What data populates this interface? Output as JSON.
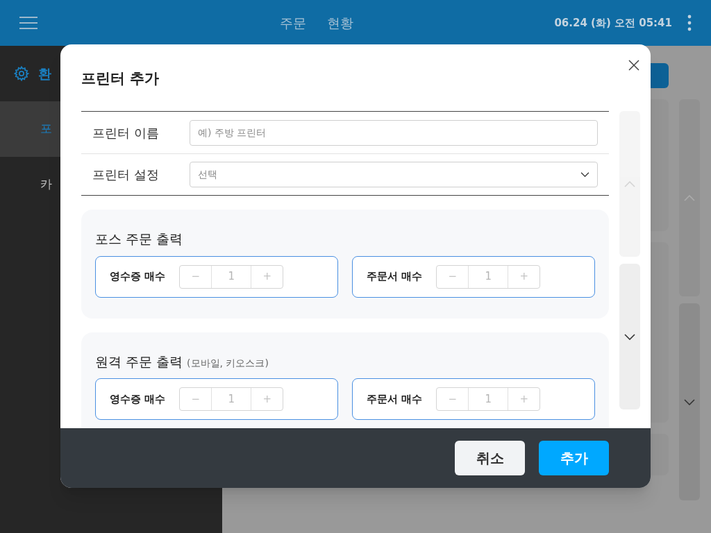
{
  "header": {
    "tabs": [
      {
        "label": "주문",
        "selected": false
      },
      {
        "label": "현황",
        "selected": false
      }
    ],
    "datetime": "06.24 (화) 오전 05:41"
  },
  "sidebar": {
    "title": "환",
    "items": [
      {
        "label": "포",
        "selected": true
      },
      {
        "label": "카",
        "selected": false
      }
    ]
  },
  "background_scroll": [
    {
      "kind": "up",
      "disabled": true
    },
    {
      "kind": "down",
      "disabled": false
    }
  ],
  "dialog": {
    "title": "프린터 추가",
    "fields": [
      {
        "label": "프린터 이름",
        "kind": "text",
        "placeholder": "예) 주방 프린터"
      },
      {
        "label": "프린터 설정",
        "kind": "select",
        "placeholder": "선택"
      }
    ],
    "sections": [
      {
        "title": "포스 주문 출력",
        "counters": [
          {
            "label": "영수증 매수",
            "minus": "−",
            "value": "1",
            "plus": "+"
          },
          {
            "label": "주문서 매수",
            "minus": "−",
            "value": "1",
            "plus": "+"
          }
        ]
      },
      {
        "title": "원격 주문 출력",
        "note": "(모바일, 키오스크)",
        "counters": [
          {
            "label": "영수증 매수",
            "minus": "−",
            "value": "1",
            "plus": "+"
          },
          {
            "label": "주문서 매수",
            "minus": "−",
            "value": "1",
            "plus": "+"
          }
        ]
      }
    ],
    "scroll_buttons": [
      {
        "kind": "up",
        "disabled": true
      },
      {
        "kind": "down",
        "disabled": false
      }
    ],
    "buttons": [
      {
        "label": "취소",
        "kind": "secondary"
      },
      {
        "label": "추가",
        "kind": "primary"
      }
    ]
  }
}
